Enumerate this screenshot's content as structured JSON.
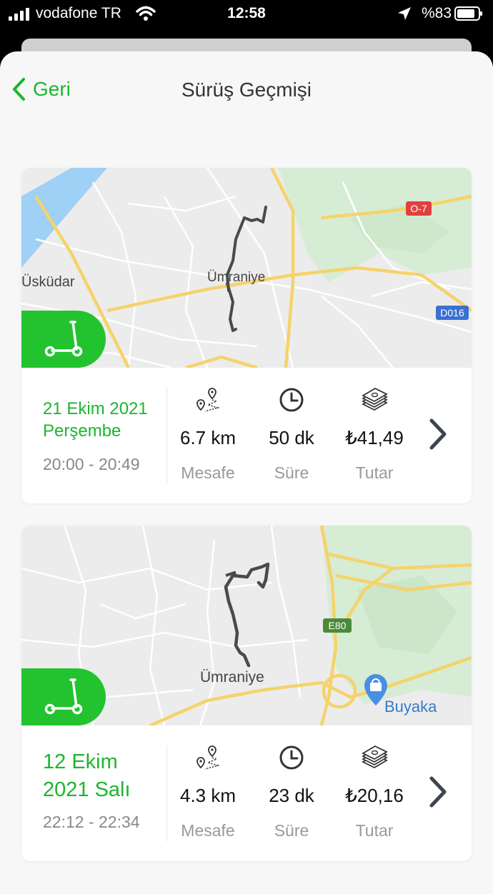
{
  "status_bar": {
    "carrier": "vodafone TR",
    "time": "12:58",
    "battery": "%83"
  },
  "nav": {
    "back_label": "Geri",
    "title": "Sürüş Geçmişi"
  },
  "rides": [
    {
      "date": "21 Ekim 2021 Perşembe",
      "time_range": "20:00 - 20:49",
      "distance": "6.7 km",
      "distance_label": "Mesafe",
      "duration": "50 dk",
      "duration_label": "Süre",
      "amount": "₺41,49",
      "amount_label": "Tutar",
      "map_labels": {
        "place_1": "Üsküdar",
        "place_2": "Ümraniye",
        "road_1": "O-7",
        "road_2": "D016"
      }
    },
    {
      "date": "12 Ekim 2021 Salı",
      "time_range": "22:12 - 22:34",
      "distance": "4.3 km",
      "distance_label": "Mesafe",
      "duration": "23 dk",
      "duration_label": "Süre",
      "amount": "₺20,16",
      "amount_label": "Tutar",
      "map_labels": {
        "place_1": "Ümraniye",
        "place_2": "Buyaka",
        "road_1": "E80"
      }
    }
  ],
  "colors": {
    "accent": "#1db52e",
    "badge": "#22c32f",
    "route": "#4a4a4a",
    "highway": "#f5d36b"
  },
  "icons": {
    "back": "chevron-left-icon",
    "vehicle": "scooter-icon",
    "distance": "route-pin-icon",
    "duration": "clock-icon",
    "amount": "money-stack-icon",
    "detail": "chevron-right-icon"
  }
}
